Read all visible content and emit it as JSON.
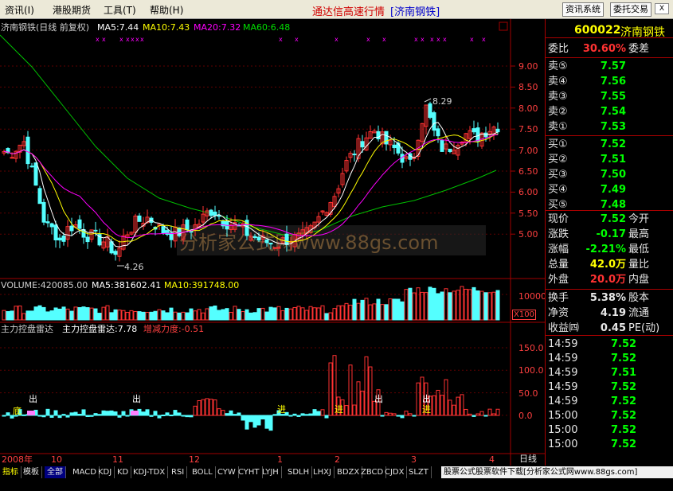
{
  "menu": [
    {
      "label": "资讯(I)"
    },
    {
      "label": "港股期货"
    },
    {
      "label": "工具(T)"
    },
    {
      "label": "帮助(H)"
    }
  ],
  "app_title": "通达信高速行情",
  "app_stock": "[济南钢铁]",
  "toolbar": {
    "btn1": "资讯系统",
    "btn2": "委托交易",
    "close": "X"
  },
  "main_header": {
    "name": "济南钢铁(日线 前复权)",
    "ma5": "MA5:7.44",
    "ma10": "MA10:7.43",
    "ma20": "MA20:7.32",
    "ma60": "MA60:6.48"
  },
  "volume_header": {
    "volume": "VOLUME:420085.00",
    "ma5": "MA5:381602.41",
    "ma10": "MA10:391748.00"
  },
  "indicator_header": {
    "name": "主力控盘雷达",
    "value": "主力控盘雷达:7.78",
    "change": "增减力度:-0.51"
  },
  "watermark": "分析家公式网www.88gs.com",
  "annotations": {
    "high": "8.29",
    "low": "4.26"
  },
  "signals": [
    "底",
    "进",
    "进",
    "进"
  ],
  "signal_out": [
    "出",
    "出",
    "出",
    "出"
  ],
  "price_axis": [
    "9.00",
    "8.50",
    "8.00",
    "7.50",
    "7.00",
    "6.50",
    "6.00",
    "5.50",
    "5.00"
  ],
  "volume_axis": {
    "label": "10000",
    "unit": "X100"
  },
  "indicator_axis": [
    "150.0",
    "100.0",
    "50.0",
    "0.0"
  ],
  "time_axis": [
    {
      "label": "2008年"
    },
    {
      "label": "10"
    },
    {
      "label": "11"
    },
    {
      "label": "12"
    },
    {
      "label": "1"
    },
    {
      "label": "2"
    },
    {
      "label": "3"
    },
    {
      "label": "4"
    }
  ],
  "period": "日线",
  "quote": {
    "code": "600022",
    "name": "济南钢铁",
    "ratio_label": "委比",
    "ratio": "30.60%",
    "diff_label": "委差",
    "asks": [
      {
        "label": "卖⑤",
        "price": "7.57"
      },
      {
        "label": "卖④",
        "price": "7.56"
      },
      {
        "label": "卖③",
        "price": "7.55"
      },
      {
        "label": "卖②",
        "price": "7.54"
      },
      {
        "label": "卖①",
        "price": "7.53"
      }
    ],
    "bids": [
      {
        "label": "买①",
        "price": "7.52"
      },
      {
        "label": "买②",
        "price": "7.51"
      },
      {
        "label": "买③",
        "price": "7.50"
      },
      {
        "label": "买④",
        "price": "7.49"
      },
      {
        "label": "买⑤",
        "price": "7.48"
      }
    ],
    "stats": [
      {
        "label": "现价",
        "value": "7.52",
        "right": "今开"
      },
      {
        "label": "涨跌",
        "value": "-0.17",
        "right": "最高"
      },
      {
        "label": "涨幅",
        "value": "-2.21%",
        "right": "最低"
      },
      {
        "label": "总量",
        "value": "42.0万",
        "right": "量比"
      },
      {
        "label": "外盘",
        "value": "20.0万",
        "right": "内盘"
      }
    ],
    "stats2": [
      {
        "label": "换手",
        "value": "5.38%",
        "right": "股本"
      },
      {
        "label": "净资",
        "value": "4.19",
        "right": "流通"
      },
      {
        "label": "收益㈣",
        "value": "0.45",
        "right": "PE(动)"
      }
    ],
    "ticks": [
      {
        "time": "14:59",
        "price": "7.52"
      },
      {
        "time": "14:59",
        "price": "7.52"
      },
      {
        "time": "14:59",
        "price": "7.51"
      },
      {
        "time": "14:59",
        "price": "7.52"
      },
      {
        "time": "14:59",
        "price": "7.52"
      },
      {
        "time": "15:00",
        "price": "7.52"
      },
      {
        "time": "15:00",
        "price": "7.52"
      },
      {
        "time": "15:00",
        "price": "7.52"
      }
    ]
  },
  "tabs": [
    {
      "label": "指标"
    },
    {
      "label": "模板"
    },
    {
      "label": "全部"
    },
    {
      "label": "MACD"
    },
    {
      "label": "KDJ"
    },
    {
      "label": "KD"
    },
    {
      "label": "KDJ-TDX"
    },
    {
      "label": "RSI"
    },
    {
      "label": "BOLL"
    },
    {
      "label": "CYW"
    },
    {
      "label": "CYHT"
    },
    {
      "label": "LYJH"
    },
    {
      "label": "SDLH"
    },
    {
      "label": "LHXJ"
    },
    {
      "label": "BDZX"
    },
    {
      "label": "ZBCD"
    },
    {
      "label": "CJDX"
    },
    {
      "label": "SLZT"
    }
  ],
  "ad_text": "股票公式股票软件下载[分析家公式网www.88gs.com]",
  "colors": {
    "up": "#ff3232",
    "down": "#54ffff",
    "ma5": "#ffffff",
    "ma10": "#ffff00",
    "ma20": "#ff00ff",
    "ma60": "#00c000"
  }
}
